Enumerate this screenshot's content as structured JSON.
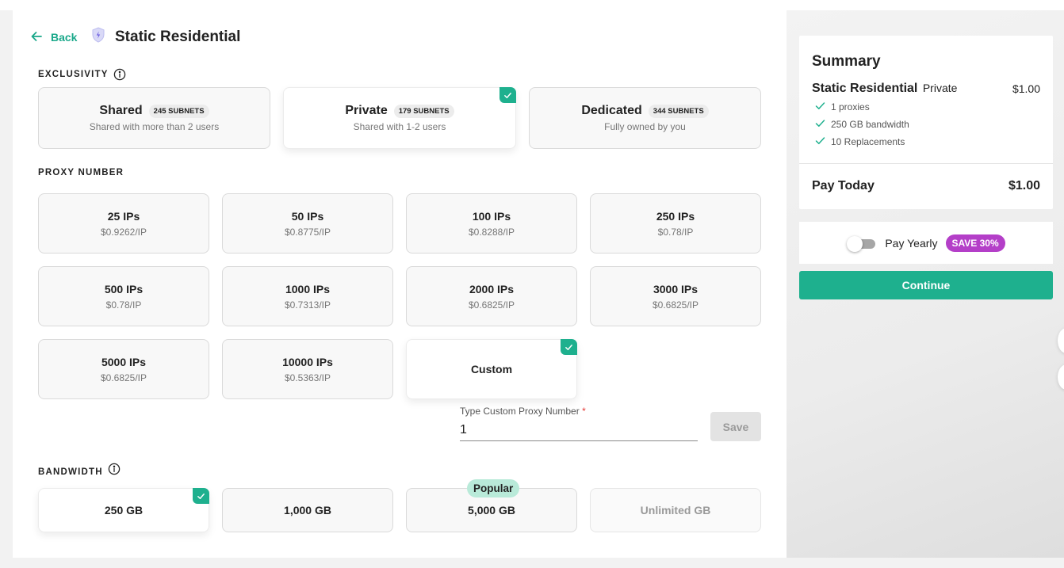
{
  "header": {
    "back_label": "Back",
    "title": "Static Residential"
  },
  "sections": {
    "exclusivity": "EXCLUSIVITY",
    "proxy_number": "PROXY NUMBER",
    "bandwidth": "BANDWIDTH"
  },
  "exclusivity": [
    {
      "name": "Shared",
      "badge": "245 SUBNETS",
      "desc": "Shared with more than 2 users",
      "selected": false
    },
    {
      "name": "Private",
      "badge": "179 SUBNETS",
      "desc": "Shared with 1-2 users",
      "selected": true
    },
    {
      "name": "Dedicated",
      "badge": "344 SUBNETS",
      "desc": "Fully owned by you",
      "selected": false
    }
  ],
  "proxy_options": [
    {
      "name": "25 IPs",
      "price": "$0.9262/IP"
    },
    {
      "name": "50 IPs",
      "price": "$0.8775/IP"
    },
    {
      "name": "100 IPs",
      "price": "$0.8288/IP"
    },
    {
      "name": "250 IPs",
      "price": "$0.78/IP"
    },
    {
      "name": "500 IPs",
      "price": "$0.78/IP"
    },
    {
      "name": "1000 IPs",
      "price": "$0.7313/IP"
    },
    {
      "name": "2000 IPs",
      "price": "$0.6825/IP"
    },
    {
      "name": "3000 IPs",
      "price": "$0.6825/IP"
    },
    {
      "name": "5000 IPs",
      "price": "$0.6825/IP"
    },
    {
      "name": "10000 IPs",
      "price": "$0.5363/IP"
    },
    {
      "name": "Custom",
      "price": "",
      "selected": true
    }
  ],
  "custom_proxy": {
    "label": "Type Custom Proxy Number",
    "required_mark": "*",
    "value": "1",
    "save_label": "Save"
  },
  "bandwidth_options": [
    {
      "name": "250 GB",
      "selected": true
    },
    {
      "name": "1,000 GB"
    },
    {
      "name": "5,000 GB",
      "badge": "Popular"
    },
    {
      "name": "Unlimited GB",
      "disabled": true
    }
  ],
  "summary": {
    "heading": "Summary",
    "product": "Static Residential",
    "tier": "Private",
    "price": "$1.00",
    "features": [
      "1 proxies",
      "250 GB bandwidth",
      "10 Replacements"
    ],
    "pay_today_label": "Pay Today",
    "pay_today_amount": "$1.00"
  },
  "billing": {
    "pay_yearly_label": "Pay Yearly",
    "save_badge": "SAVE 30%",
    "yearly_enabled": false
  },
  "actions": {
    "continue_label": "Continue"
  },
  "colors": {
    "accent": "#1eb08e",
    "save_badge": "#b43fc8",
    "popular_badge": "#b9ead9"
  }
}
